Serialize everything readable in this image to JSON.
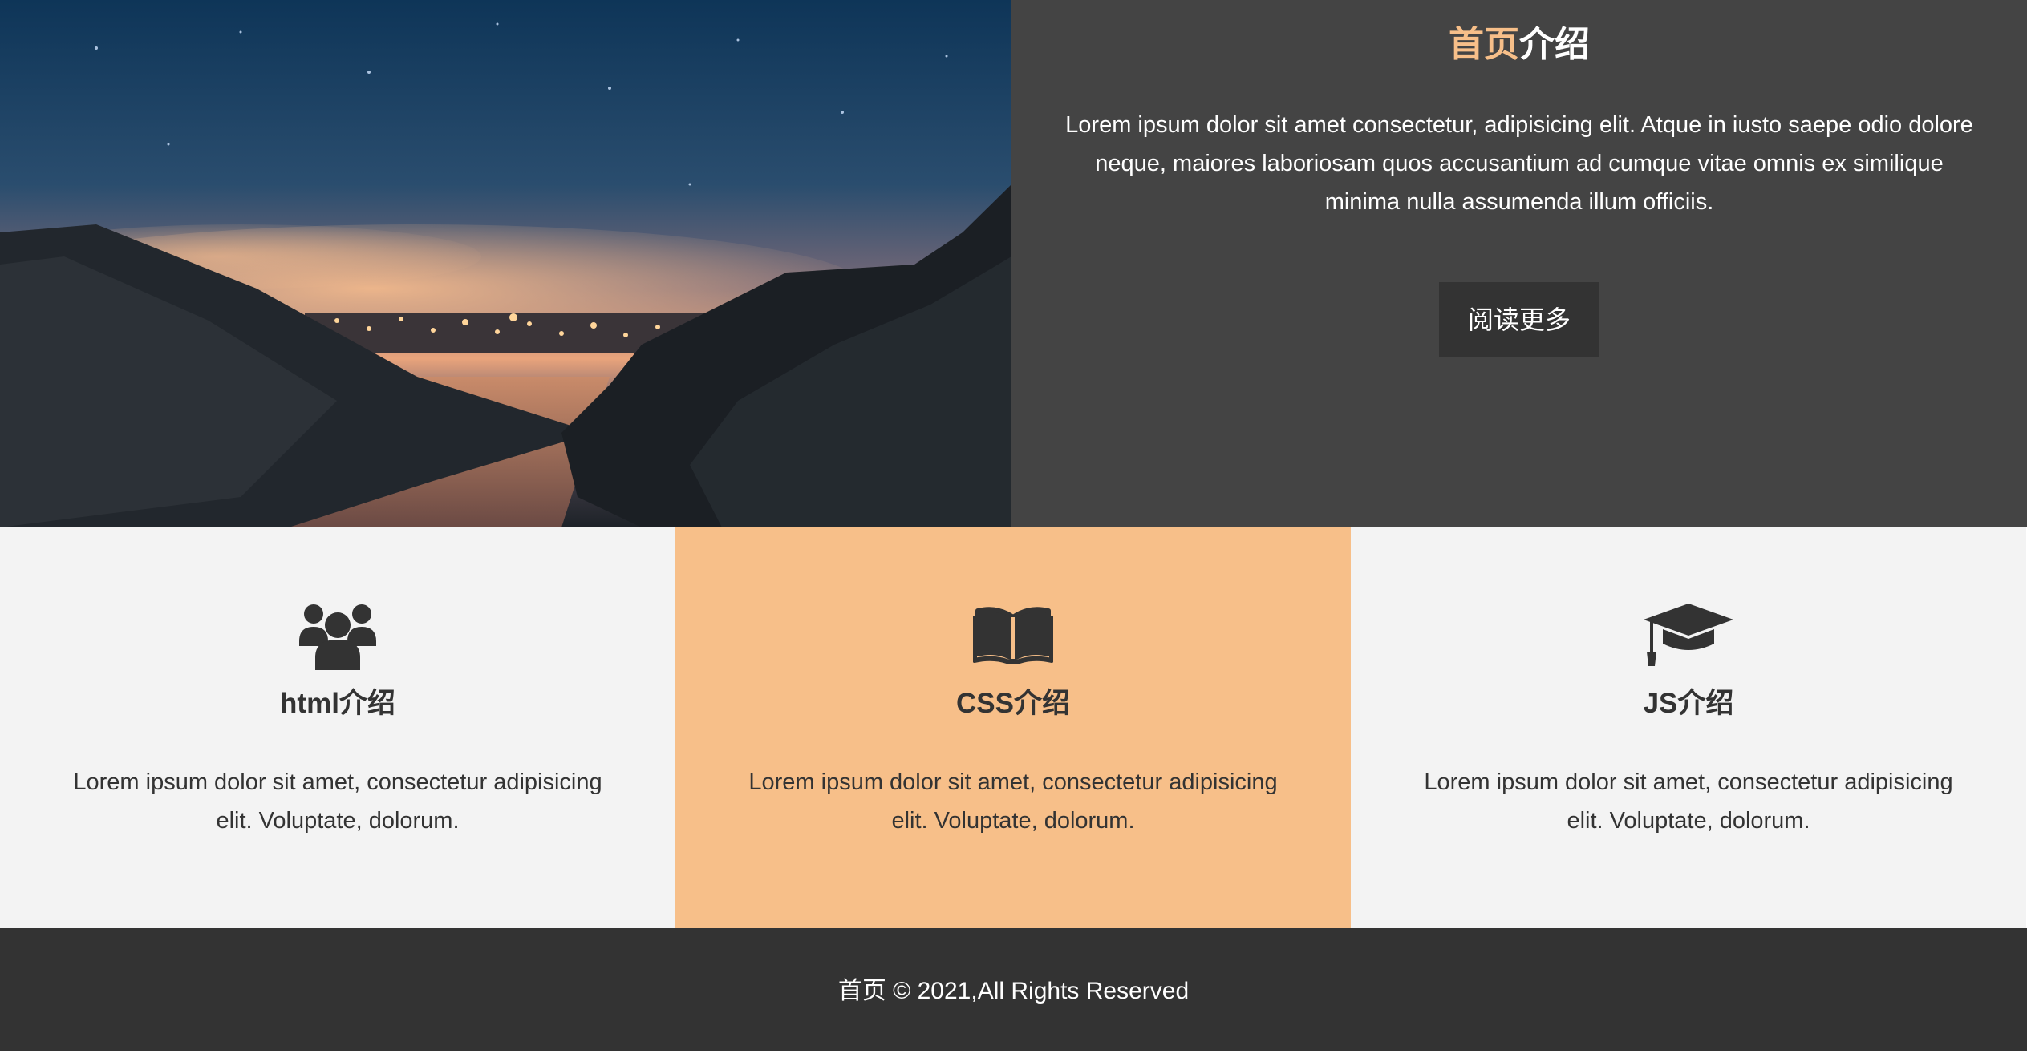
{
  "hero": {
    "title_accent": "首页",
    "title_rest": "介绍",
    "body": "Lorem ipsum dolor sit amet consectetur, adipisicing elit. Atque in iusto saepe odio dolore neque, maiores laboriosam quos accusantium ad cumque vitae omnis ex similique minima nulla assumenda illum officiis.",
    "read_more_label": "阅读更多",
    "image_icon": "night-landscape-photo"
  },
  "features": [
    {
      "icon": "users-icon",
      "title": "html介绍",
      "body": "Lorem ipsum dolor sit amet, consectetur adipisicing elit. Voluptate, dolorum."
    },
    {
      "icon": "book-icon",
      "title": "CSS介绍",
      "body": "Lorem ipsum dolor sit amet, consectetur adipisicing elit. Voluptate, dolorum."
    },
    {
      "icon": "graduation-cap-icon",
      "title": "JS介绍",
      "body": "Lorem ipsum dolor sit amet, consectetur adipisicing elit. Voluptate, dolorum."
    }
  ],
  "footer": {
    "text": "首页 © 2021,All Rights Reserved"
  },
  "colors": {
    "accent": "#f7bf89",
    "hero_bg": "#444444",
    "button_bg": "#333333",
    "feature_bg": "#f3f3f3",
    "footer_bg": "#333333"
  }
}
